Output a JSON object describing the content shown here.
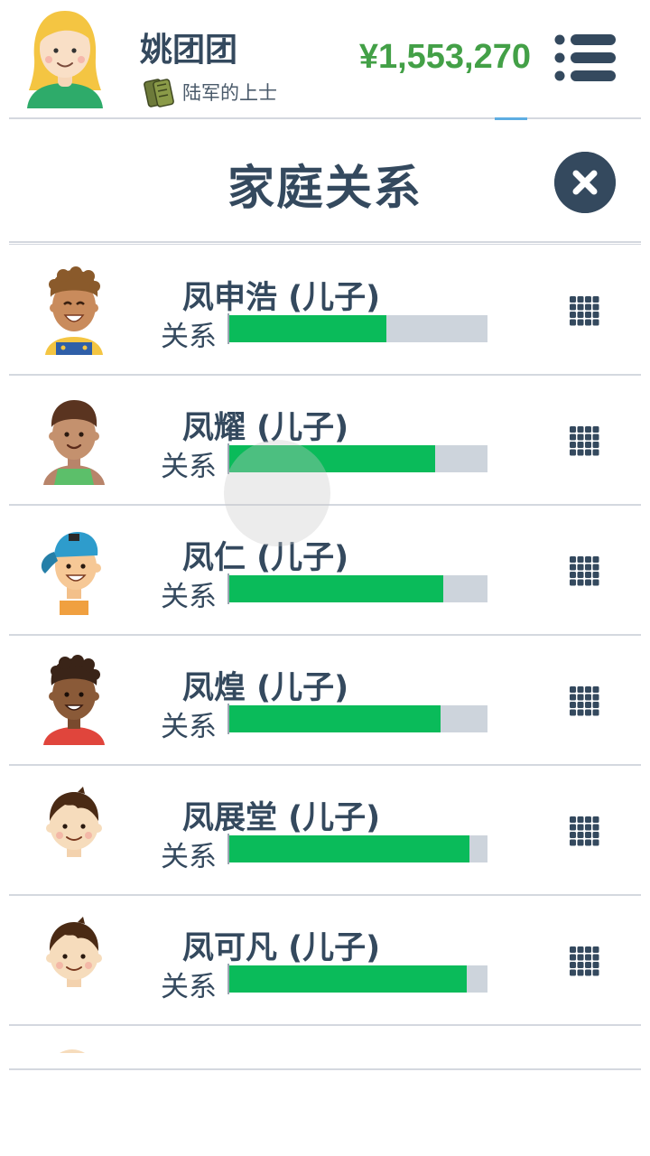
{
  "header": {
    "player_name": "姚团团",
    "rank_title": "陆军的上士",
    "money": "¥1,553,270"
  },
  "dialog": {
    "title": "家庭关系",
    "relation_label": "关系"
  },
  "family": [
    {
      "name": "凤申浩 (儿子)",
      "relationship_level": 0.61
    },
    {
      "name": "凤耀 (儿子)",
      "relationship_level": 0.8
    },
    {
      "name": "凤仁 (儿子)",
      "relationship_level": 0.83
    },
    {
      "name": "凤煌 (儿子)",
      "relationship_level": 0.82
    },
    {
      "name": "凤展堂 (儿子)",
      "relationship_level": 0.93
    },
    {
      "name": "凤可凡 (儿子)",
      "relationship_level": 0.92
    }
  ],
  "colors": {
    "money": "#43a047",
    "bar_fill": "#0abb5a",
    "bar_track": "#cdd4dc",
    "text": "#34495e"
  },
  "icons": {
    "menu": "menu-list-icon",
    "close": "close-x-icon",
    "row_action": "grid-dots-icon",
    "rank": "rank-insignia-icon"
  }
}
